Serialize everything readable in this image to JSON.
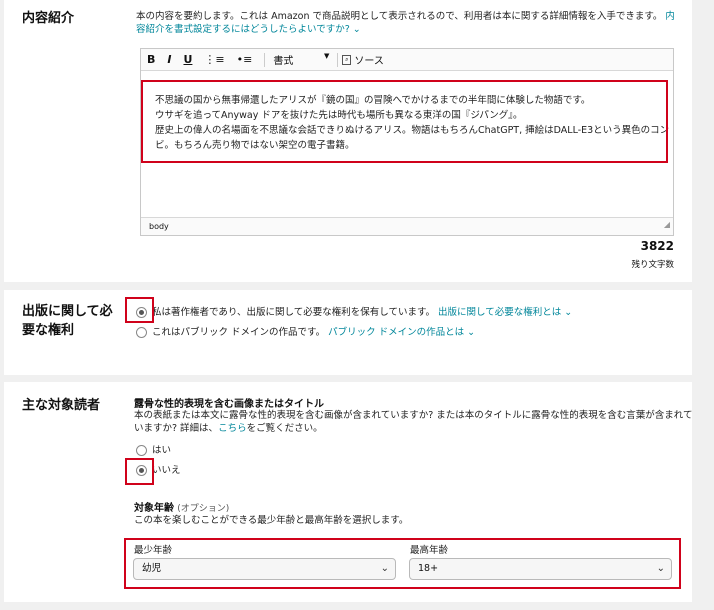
{
  "description": {
    "title": "内容紹介",
    "help_text": "本の内容を要約します。これは Amazon で商品説明として表示されるので、利用者は本に関する詳細情報を入手できます。",
    "help_link": "内容紹介を書式設定するにはどうしたらよいですか?",
    "toolbar": {
      "bold": "B",
      "italic": "I",
      "underline": "U",
      "format_label": "書式",
      "source_label": "ソース"
    },
    "body_lines": [
      "不思議の国から無事帰還したアリスが『鏡の国』の冒険へでかけるまでの半年間に体験した物語です。",
      "ウサギを追ってAnyway ドアを抜けた先は時代も場所も異なる東洋の国『ジパング』。",
      "歴史上の偉人の名場面を不思議な会話できりぬけるアリス。物語はもちろんChatGPT, 挿絵はDALL-E3という異色のコン",
      "ビ。もちろん売り物ではない架空の電子書籍。"
    ],
    "status_path": "body",
    "remaining_count": "3822",
    "remaining_label": "残り文字数"
  },
  "rights": {
    "title_line1": "出版に関して必",
    "title_line2": "要な権利",
    "option1": "私は著作権者であり、出版に関して必要な権利を保有しています。",
    "option1_link": "出版に関して必要な権利とは",
    "option2": "これはパブリック ドメインの作品です。",
    "option2_link": "パブリック ドメインの作品とは",
    "selected": 1
  },
  "audience": {
    "title": "主な対象読者",
    "explicit_heading": "露骨な性的表現を含む画像またはタイトル",
    "explicit_text_1": "本の表紙または本文に露骨な性的表現を含む画像が含まれていますか? または本のタイトルに露骨な性的表現を含む言葉が含まれて",
    "explicit_text_2": "いますか? 詳細は、",
    "explicit_link": "こちら",
    "explicit_text_3": "をご覧ください。",
    "yes_label": "はい",
    "no_label": "いいえ",
    "selected": "no",
    "age_heading": "対象年齢",
    "age_optional": "(オプション)",
    "age_desc": "この本を楽しむことができる最少年齢と最高年齢を選択します。",
    "min_label": "最少年齢",
    "min_value": "幼児",
    "max_label": "最高年齢",
    "max_value": "18+"
  }
}
